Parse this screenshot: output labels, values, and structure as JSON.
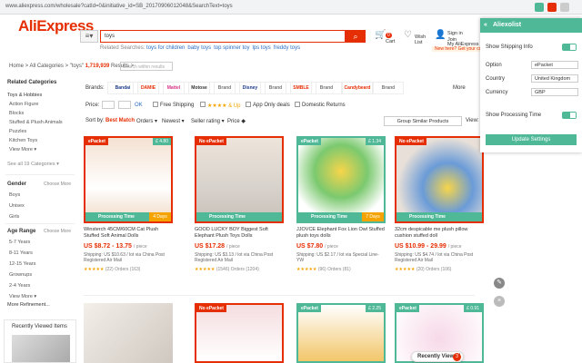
{
  "browser": {
    "url": "www.aliexpress.com/wholesale?catId=0&initiative_id=SB_20170906012048&SearchText=toys"
  },
  "header": {
    "logo": "AliExpress",
    "search_value": "toys",
    "related_label": "Related Searches:",
    "related": [
      "toys for children",
      "baby toys",
      "top spinner toy",
      "lps toys",
      "freddy toys"
    ],
    "cart_label": "Cart",
    "cart_count": "0",
    "wish_label": "Wish List",
    "signin_label": "Sign in",
    "join_label": "Join",
    "myali_label": "My AliExpress",
    "promo": "New here? Get your coupons!"
  },
  "breadcrumb": {
    "text": "Home > All Categories > \"toys\"",
    "count": "1,719,939",
    "suffix": "Results >",
    "within_placeholder": "Search within results"
  },
  "sidebar": {
    "related_title": "Related Categories",
    "cat_parent": "Toys & Hobbies",
    "cats": [
      "Action Figure",
      "Blocks",
      "Stuffed & Plush Animals",
      "Puzzles",
      "Kitchen Toys",
      "View More ▾"
    ],
    "see_all": "See all 19 Categories ▾",
    "gender_title": "Gender",
    "gender_more": "Choose More",
    "genders": [
      "Boys",
      "Unisex",
      "Girls"
    ],
    "age_title": "Age Range",
    "age_more": "Choose More",
    "ages": [
      "5-7 Years",
      "8-11 Years",
      "12-15 Years",
      "Grownups",
      "2-4 Years",
      "View More ▾",
      "More Refinement..."
    ],
    "recent_title": "Recently Viewed Items"
  },
  "filters": {
    "brands_label": "Brands:",
    "brands": [
      "Bandai",
      "DAMIE",
      "Mattel",
      "Motose",
      "Brand",
      "Disney",
      "Brand",
      "SMBLE",
      "Brand",
      "Candybeard",
      "Brand"
    ],
    "more": "More",
    "price_label": "Price:",
    "price_ok": "OK",
    "free_ship": "Free Shipping",
    "rating": "★★★★ & Up",
    "app_deals": "App Only deals",
    "domestic": "Domestic Returns",
    "sort_label": "Sort by:",
    "sort_best": "Best Match",
    "sort_orders": "Orders ▾",
    "sort_newest": "Newest ▾",
    "sort_seller": "Seller rating ▾",
    "sort_price": "Price ◆",
    "group": "Group Similar Products",
    "view": "View:"
  },
  "products": [
    {
      "badge": "ePacket",
      "price_tag": "£ 4.80",
      "ptime": "Processing Time",
      "days": "4 Days",
      "title": "Winsterch 45CM/60CM Cat Plush Stuffed Soft Animal Dolls",
      "price": "US $8.72 - 13.75",
      "unit": "/ piece",
      "ship": "Shipping: US $10.63 / lot via China Post Registered Air Mail",
      "rating": "★★★★★",
      "reviews": "(22)",
      "orders": "Orders (163)"
    },
    {
      "badge": "No ePacket",
      "price_tag": "",
      "ptime": "Processing Time",
      "days": "",
      "title": "GOOD LUCKY BOY Biggest Soft Elephant Plush Toys Dolls",
      "price": "US $17.28",
      "unit": "/ piece",
      "ship": "Shipping: US $3.13 / lot via China Post Registered Air Mail",
      "rating": "★★★★★",
      "reviews": "(1546)",
      "orders": "Orders (1204)"
    },
    {
      "badge": "ePacket",
      "price_tag": "£ 1.34",
      "ptime": "Processing Time",
      "days": "7 Days",
      "title": "JJOVCE Elephant Fox Lion Owl Stuffed plush toys dolls",
      "price": "US $7.80",
      "unit": "/ piece",
      "ship": "Shipping: US $2.17 / lot via Special Line-YW",
      "rating": "★★★★★",
      "reviews": "(96)",
      "orders": "Orders (81)"
    },
    {
      "badge": "No ePacket",
      "price_tag": "",
      "ptime": "Processing Time",
      "days": "",
      "title": "32cm despicable me plush pillow cushion stuffed doll",
      "price": "US $10.99 - 29.99",
      "unit": "/ piece",
      "ship": "Shipping: US $4.74 / lot via China Post Registered Air Mail",
      "rating": "★★★★★",
      "reviews": "(20)",
      "orders": "Orders (106)"
    }
  ],
  "row2_badges": [
    {
      "badge": "No ePacket",
      "price_tag": ""
    },
    {
      "badge": "No ePacket",
      "price_tag": ""
    },
    {
      "badge": "ePacket",
      "price_tag": "£ 2.25"
    },
    {
      "badge": "ePacket",
      "price_tag": "£ 0.91"
    }
  ],
  "panel": {
    "title": "Aliexolist",
    "show_shipping": "Show Shipping Info",
    "option_label": "Option",
    "option_value": "ePacket",
    "country_label": "Country",
    "country_value": "United Kingdom",
    "currency_label": "Currency",
    "currency_value": "GBP",
    "show_processing": "Show Processing Time",
    "update": "Update Settings"
  },
  "recently_viewed": {
    "label": "Recently Viewed",
    "count": "3"
  },
  "colors": {
    "brand": "#e62e04",
    "accent": "#4fb897",
    "star": "#f4a300"
  }
}
